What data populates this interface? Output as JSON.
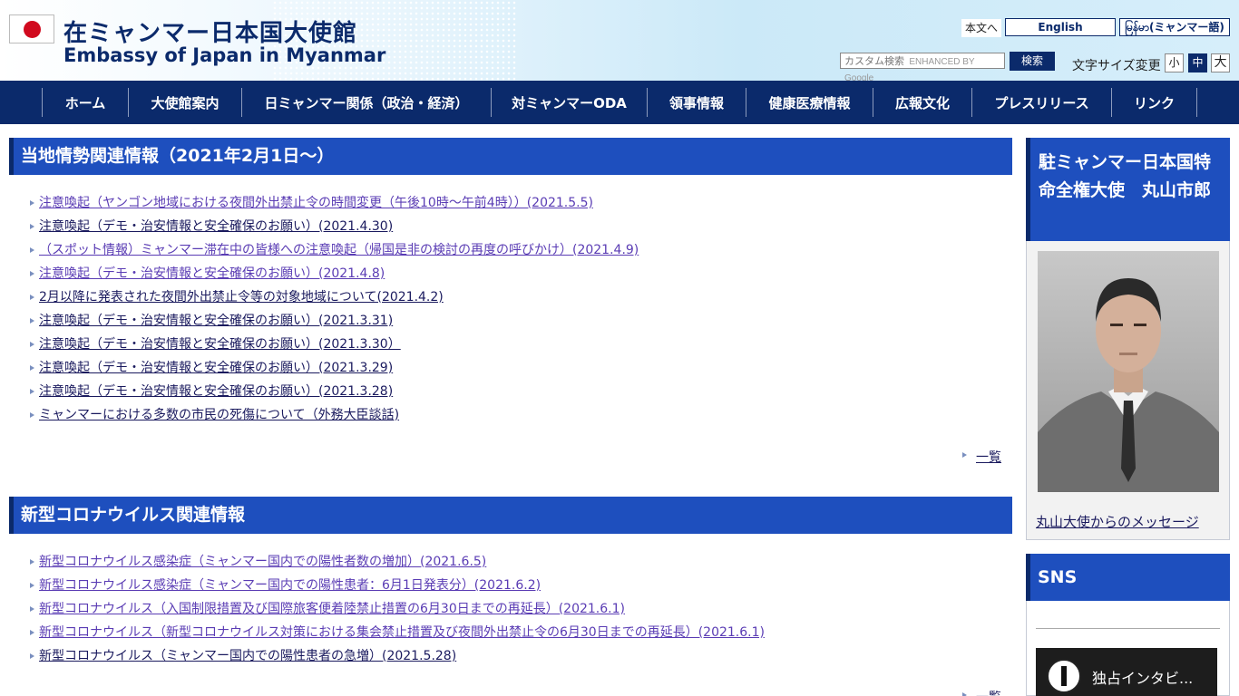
{
  "header": {
    "title_jp": "在ミャンマー日本国大使館",
    "title_en": "Embassy of Japan in Myanmar",
    "skip_link": "本文へ",
    "lang_english": "English",
    "lang_myanmar": "မြန်မာ(ミャンマー語)",
    "search_placeholder": "カスタム検索",
    "search_branding": "ENHANCED BY Google",
    "search_button": "検索",
    "font_size_label": "文字サイズ変更",
    "font_small": "小",
    "font_medium": "中",
    "font_large": "大"
  },
  "nav": {
    "items": [
      {
        "label": "ホーム"
      },
      {
        "label": "大使館案内"
      },
      {
        "label": "日ミャンマー関係（政治・経済）"
      },
      {
        "label": "対ミャンマーODA"
      },
      {
        "label": "領事情報"
      },
      {
        "label": "健康医療情報"
      },
      {
        "label": "広報文化"
      },
      {
        "label": "プレスリリース"
      },
      {
        "label": "リンク"
      }
    ]
  },
  "local_situation": {
    "heading": "当地情勢関連情報（2021年2月1日～）",
    "items": [
      {
        "text": "注意喚起（ヤンゴン地域における夜間外出禁止令の時間変更（午後10時～午前4時））(2021.5.5)",
        "visited": true
      },
      {
        "text": "注意喚起（デモ・治安情報と安全確保のお願い）(2021.4.30)",
        "visited": false
      },
      {
        "text": "（スポット情報）ミャンマー滞在中の皆様への注意喚起（帰国是非の検討の再度の呼びかけ）(2021.4.9)",
        "visited": true
      },
      {
        "text": "注意喚起（デモ・治安情報と安全確保のお願い）(2021.4.8)",
        "visited": true
      },
      {
        "text": "2月以降に発表された夜間外出禁止令等の対象地域について(2021.4.2)",
        "visited": false
      },
      {
        "text": "注意喚起（デモ・治安情報と安全確保のお願い）(2021.3.31)",
        "visited": false
      },
      {
        "text": "注意喚起（デモ・治安情報と安全確保のお願い）(2021.3.30）",
        "visited": false
      },
      {
        "text": "注意喚起（デモ・治安情報と安全確保のお願い）(2021.3.29)",
        "visited": false
      },
      {
        "text": "注意喚起（デモ・治安情報と安全確保のお願い）(2021.3.28)",
        "visited": false
      },
      {
        "text": "ミャンマーにおける多数の市民の死傷について（外務大臣談話)",
        "visited": false
      }
    ],
    "more": "一覧"
  },
  "covid": {
    "heading": "新型コロナウイルス関連情報",
    "items": [
      {
        "text": "新型コロナウイルス感染症（ミャンマー国内での陽性者数の増加）(2021.6.5)",
        "visited": true
      },
      {
        "text": "新型コロナウイルス感染症（ミャンマー国内での陽性患者：6月1日発表分）(2021.6.2)",
        "visited": true
      },
      {
        "text": "新型コロナウイルス（入国制限措置及び国際旅客便着陸禁止措置の6月30日までの再延長）(2021.6.1)",
        "visited": true
      },
      {
        "text": "新型コロナウイルス（新型コロナウイルス対策における集会禁止措置及び夜間外出禁止令の6月30日までの再延長）(2021.6.1)",
        "visited": true
      },
      {
        "text": "新型コロナウイルス（ミャンマー国内での陽性患者の急増）(2021.5.28)",
        "visited": false
      }
    ],
    "more": "一覧"
  },
  "sidebar": {
    "ambassador_heading": "駐ミャンマー日本国特命全権大使　丸山市郎",
    "ambassador_message_link": "丸山大使からのメッセージ",
    "sns_heading": "SNS",
    "video_title": "独占インタビ..."
  },
  "colors": {
    "navy": "#0b2a6b",
    "section_blue": "#1e4fbe",
    "visited_link": "#5a3cb4",
    "link": "#1a1a5e"
  }
}
